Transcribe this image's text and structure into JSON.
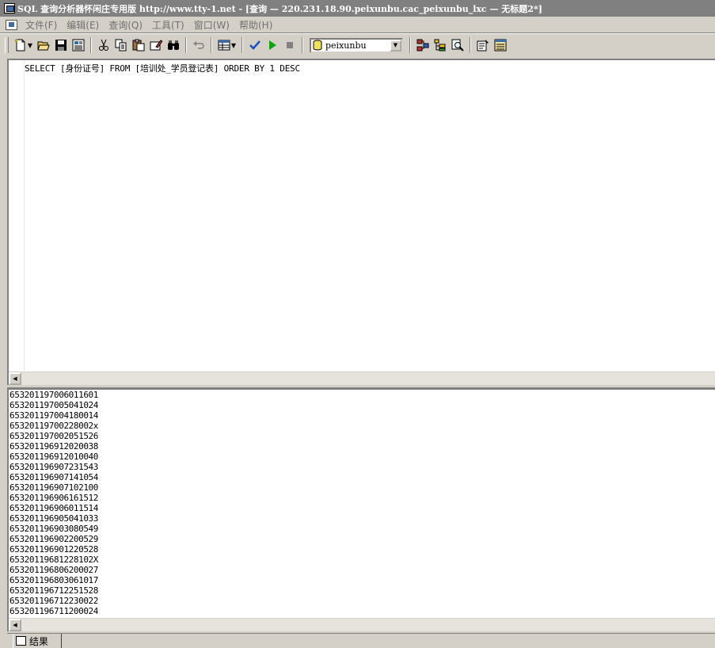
{
  "window": {
    "title": "SQL 查询分析器怀闲庄专用版  http://www.tty-1.net - [查询 — 220.231.18.90.peixunbu.cac_peixunbu_lxc — 无标题2*]"
  },
  "menu": {
    "items": [
      {
        "label": "文件(F)"
      },
      {
        "label": "编辑(E)"
      },
      {
        "label": "查询(Q)"
      },
      {
        "label": "工具(T)"
      },
      {
        "label": "窗口(W)"
      },
      {
        "label": "帮助(H)"
      }
    ]
  },
  "toolbar": {
    "database": "peixunbu"
  },
  "editor": {
    "query": "SELECT [身份证号] FROM [培训处_学员登记表] ORDER BY 1 DESC"
  },
  "results": {
    "rows": [
      "653201197006011601",
      "653201197005041024",
      "653201197004180014",
      "65320119700228002x",
      "653201197002051526",
      "653201196912020038",
      "653201196912010040",
      "653201196907231543",
      "653201196907141054",
      "653201196907102100",
      "653201196906161512",
      "653201196906011514",
      "653201196905041033",
      "653201196903080549",
      "653201196902200529",
      "653201196901220528",
      "65320119681228102X",
      "653201196806200027",
      "653201196803061017",
      "653201196712251528",
      "653201196712230022",
      "653201196711200024"
    ]
  },
  "tabs": {
    "results_label": "结果"
  }
}
